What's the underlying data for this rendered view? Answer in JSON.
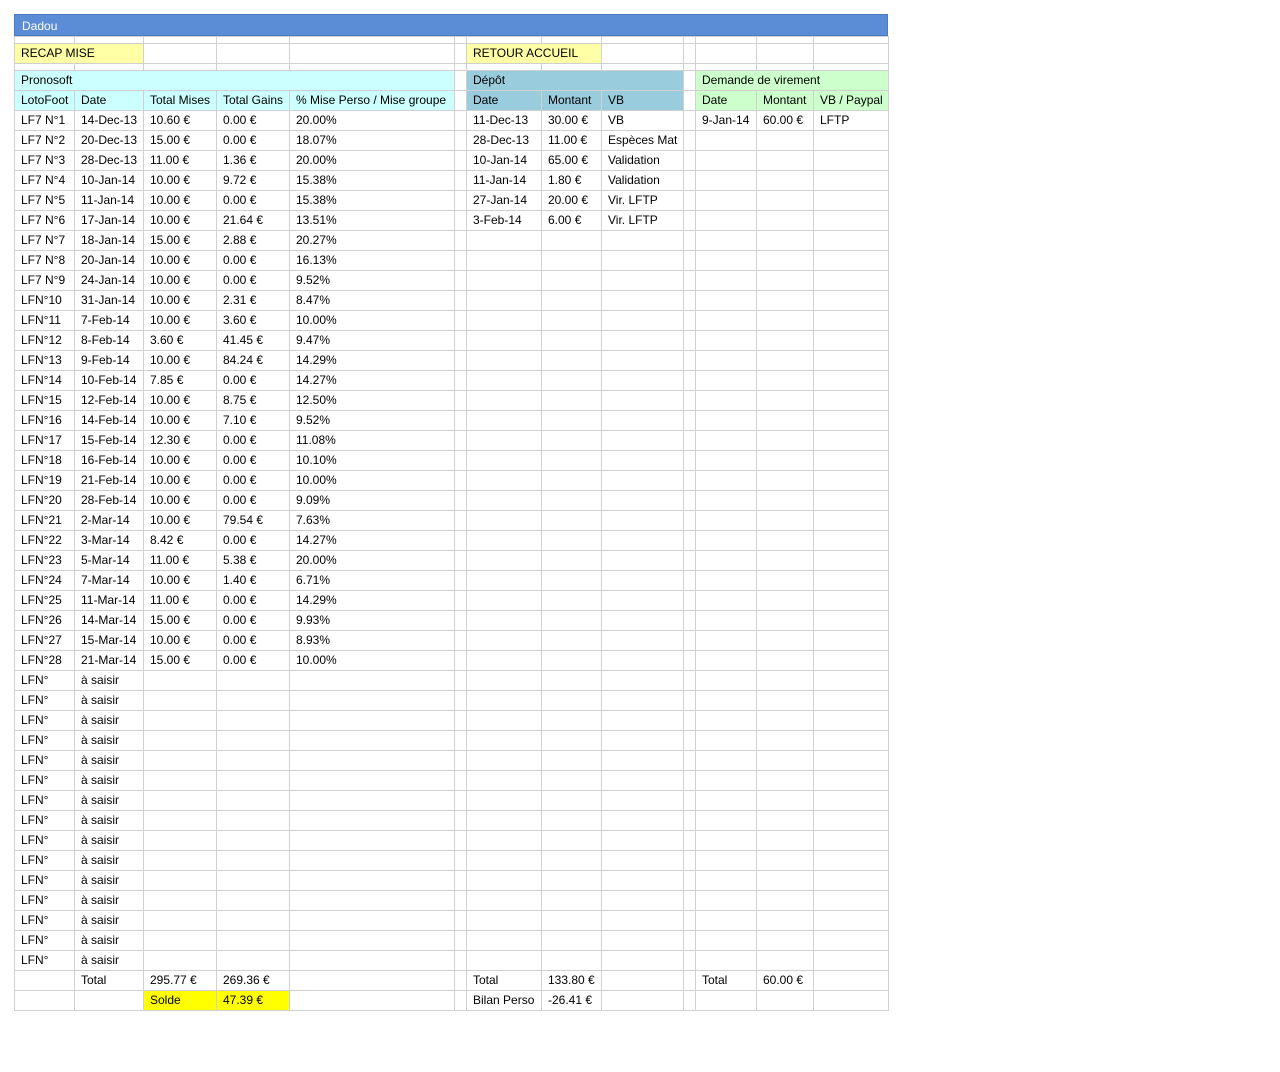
{
  "title": "Dadou",
  "buttons": {
    "recap": "RECAP MISE",
    "retour": "RETOUR ACCUEIL"
  },
  "sections": {
    "pronosoft": "Pronosoft",
    "depot": "Dépôt",
    "virement": "Demande de virement"
  },
  "headers": {
    "pronosoft": [
      "LotoFoot",
      "Date",
      "Total Mises",
      "Total Gains",
      "% Mise Perso / Mise groupe"
    ],
    "depot": [
      "Date",
      "Montant",
      "VB"
    ],
    "virement": [
      "Date",
      "Montant",
      "VB / Paypal"
    ]
  },
  "pronosoft_rows": [
    [
      "LF7 N°1",
      "14-Dec-13",
      "10.60 €",
      "0.00 €",
      "20.00%"
    ],
    [
      "LF7 N°2",
      "20-Dec-13",
      "15.00 €",
      "0.00 €",
      "18.07%"
    ],
    [
      "LF7 N°3",
      "28-Dec-13",
      "11.00 €",
      "1.36 €",
      "20.00%"
    ],
    [
      "LF7 N°4",
      "10-Jan-14",
      "10.00 €",
      "9.72 €",
      "15.38%"
    ],
    [
      "LF7 N°5",
      "11-Jan-14",
      "10.00 €",
      "0.00 €",
      "15.38%"
    ],
    [
      "LF7 N°6",
      "17-Jan-14",
      "10.00 €",
      "21.64 €",
      "13.51%"
    ],
    [
      "LF7 N°7",
      "18-Jan-14",
      "15.00 €",
      "2.88 €",
      "20.27%"
    ],
    [
      "LF7 N°8",
      "20-Jan-14",
      "10.00 €",
      "0.00 €",
      "16.13%"
    ],
    [
      "LF7 N°9",
      "24-Jan-14",
      "10.00 €",
      "0.00 €",
      "9.52%"
    ],
    [
      "LFN°10",
      "31-Jan-14",
      "10.00 €",
      "2.31 €",
      "8.47%"
    ],
    [
      "LFN°11",
      "7-Feb-14",
      "10.00 €",
      "3.60 €",
      "10.00%"
    ],
    [
      "LFN°12",
      "8-Feb-14",
      "3.60 €",
      "41.45 €",
      "9.47%"
    ],
    [
      "LFN°13",
      "9-Feb-14",
      "10.00 €",
      "84.24 €",
      "14.29%"
    ],
    [
      "LFN°14",
      "10-Feb-14",
      "7.85 €",
      "0.00 €",
      "14.27%"
    ],
    [
      "LFN°15",
      "12-Feb-14",
      "10.00 €",
      "8.75 €",
      "12.50%"
    ],
    [
      "LFN°16",
      "14-Feb-14",
      "10.00 €",
      "7.10 €",
      "9.52%"
    ],
    [
      "LFN°17",
      "15-Feb-14",
      "12.30 €",
      "0.00 €",
      "11.08%"
    ],
    [
      "LFN°18",
      "16-Feb-14",
      "10.00 €",
      "0.00 €",
      "10.10%"
    ],
    [
      "LFN°19",
      "21-Feb-14",
      "10.00 €",
      "0.00 €",
      "10.00%"
    ],
    [
      "LFN°20",
      "28-Feb-14",
      "10.00 €",
      "0.00 €",
      "9.09%"
    ],
    [
      "LFN°21",
      "2-Mar-14",
      "10.00 €",
      "79.54 €",
      "7.63%"
    ],
    [
      "LFN°22",
      "3-Mar-14",
      "8.42 €",
      "0.00 €",
      "14.27%"
    ],
    [
      "LFN°23",
      "5-Mar-14",
      "11.00 €",
      "5.38 €",
      "20.00%"
    ],
    [
      "LFN°24",
      "7-Mar-14",
      "10.00 €",
      "1.40 €",
      "6.71%"
    ],
    [
      "LFN°25",
      "11-Mar-14",
      "11.00 €",
      "0.00 €",
      "14.29%"
    ],
    [
      "LFN°26",
      "14-Mar-14",
      "15.00 €",
      "0.00 €",
      "9.93%"
    ],
    [
      "LFN°27",
      "15-Mar-14",
      "10.00 €",
      "0.00 €",
      "8.93%"
    ],
    [
      "LFN°28",
      "21-Mar-14",
      "15.00 €",
      "0.00 €",
      "10.00%"
    ],
    [
      "LFN°",
      "à saisir",
      "",
      "",
      ""
    ],
    [
      "LFN°",
      "à saisir",
      "",
      "",
      ""
    ],
    [
      "LFN°",
      "à saisir",
      "",
      "",
      ""
    ],
    [
      "LFN°",
      "à saisir",
      "",
      "",
      ""
    ],
    [
      "LFN°",
      "à saisir",
      "",
      "",
      ""
    ],
    [
      "LFN°",
      "à saisir",
      "",
      "",
      ""
    ],
    [
      "LFN°",
      "à saisir",
      "",
      "",
      ""
    ],
    [
      "LFN°",
      "à saisir",
      "",
      "",
      ""
    ],
    [
      "LFN°",
      "à saisir",
      "",
      "",
      ""
    ],
    [
      "LFN°",
      "à saisir",
      "",
      "",
      ""
    ],
    [
      "LFN°",
      "à saisir",
      "",
      "",
      ""
    ],
    [
      "LFN°",
      "à saisir",
      "",
      "",
      ""
    ],
    [
      "LFN°",
      "à saisir",
      "",
      "",
      ""
    ],
    [
      "LFN°",
      "à saisir",
      "",
      "",
      ""
    ],
    [
      "LFN°",
      "à saisir",
      "",
      "",
      ""
    ]
  ],
  "depot_rows": [
    [
      "11-Dec-13",
      "30.00 €",
      "VB"
    ],
    [
      "28-Dec-13",
      "11.00 €",
      "Espèces Mat"
    ],
    [
      "10-Jan-14",
      "65.00 €",
      "Validation"
    ],
    [
      "11-Jan-14",
      "1.80 €",
      "Validation"
    ],
    [
      "27-Jan-14",
      "20.00 €",
      "Vir. LFTP"
    ],
    [
      "3-Feb-14",
      "6.00 €",
      "Vir. LFTP"
    ]
  ],
  "virement_rows": [
    [
      "9-Jan-14",
      "60.00 €",
      "LFTP"
    ]
  ],
  "totals": {
    "label": "Total",
    "mises": "295.77 €",
    "gains": "269.36 €",
    "depot_label": "Total",
    "depot": "133.80 €",
    "virement_label": "Total",
    "virement": "60.00 €"
  },
  "solde": {
    "label": "Solde",
    "value": "47.39 €",
    "bilan_label": "Bilan Perso",
    "bilan_value": "-26.41 €"
  }
}
